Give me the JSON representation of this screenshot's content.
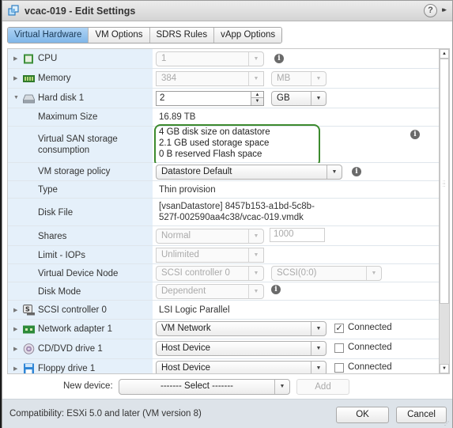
{
  "window": {
    "title": "vcac-019 - Edit Settings",
    "help_label": "?",
    "expand_label": "▸▸"
  },
  "tabs": [
    {
      "label": "Virtual Hardware",
      "active": true
    },
    {
      "label": "VM Options",
      "active": false
    },
    {
      "label": "SDRS Rules",
      "active": false
    },
    {
      "label": "vApp Options",
      "active": false
    }
  ],
  "hardware": {
    "cpu": {
      "label": "CPU",
      "value": "1"
    },
    "memory": {
      "label": "Memory",
      "value": "384",
      "unit": "MB"
    },
    "hard_disk": {
      "label": "Hard disk 1",
      "value": "2",
      "unit": "GB",
      "max_size": {
        "label": "Maximum Size",
        "value": "16.89 TB"
      },
      "vsan": {
        "label_line1": "Virtual SAN storage",
        "label_line2": "consumption",
        "lines": [
          "4 GB disk size on datastore",
          "2.1 GB used storage space",
          "0 B reserved Flash space"
        ],
        "highlight_color": "#3c8a2e"
      },
      "storage_policy": {
        "label": "VM storage policy",
        "value": "Datastore Default"
      },
      "type": {
        "label": "Type",
        "value": "Thin provision"
      },
      "disk_file": {
        "label": "Disk File",
        "line1": "[vsanDatastore] 8457b153-a1bd-5c8b-",
        "line2": "527f-002590aa4c38/vcac-019.vmdk"
      },
      "shares": {
        "label": "Shares",
        "value": "Normal",
        "amount": "1000"
      },
      "limit_iops": {
        "label": "Limit - IOPs",
        "value": "Unlimited"
      },
      "device_node": {
        "label": "Virtual Device Node",
        "controller": "SCSI controller 0",
        "node": "SCSI(0:0)"
      },
      "disk_mode": {
        "label": "Disk Mode",
        "value": "Dependent"
      }
    },
    "scsi": {
      "label": "SCSI controller 0",
      "value": "LSI Logic Parallel"
    },
    "network": {
      "label": "Network adapter 1",
      "value": "VM Network",
      "connected_label": "Connected",
      "connected": true
    },
    "cddvd": {
      "label": "CD/DVD drive 1",
      "value": "Host Device",
      "connected_label": "Connected",
      "connected": false
    },
    "floppy": {
      "label": "Floppy drive 1",
      "value": "Host Device",
      "connected_label": "Connected",
      "connected": false
    }
  },
  "new_device": {
    "label": "New device:",
    "select_value": "------- Select -------",
    "add_label": "Add"
  },
  "footer": {
    "compatibility": "Compatibility: ESXi 5.0 and later (VM version 8)",
    "ok_label": "OK",
    "cancel_label": "Cancel"
  },
  "glyphs": {
    "collapsed": "▶",
    "expanded": "▼",
    "dropdown": "▼",
    "spin_up": "▲",
    "spin_down": "▼",
    "info": "i",
    "check": "✓",
    "scroll_up": "▲",
    "scroll_down": "▼"
  }
}
